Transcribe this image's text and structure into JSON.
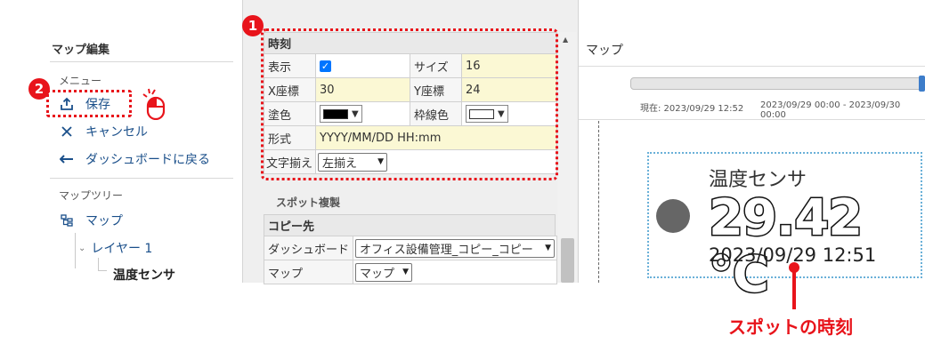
{
  "sidebar": {
    "title": "マップ編集",
    "menu_heading": "メニュー",
    "items": [
      {
        "label": "保存",
        "icon": "upload-icon"
      },
      {
        "label": "キャンセル",
        "icon": "close-icon"
      },
      {
        "label": "ダッシュボードに戻る",
        "icon": "back-arrow-icon"
      }
    ],
    "tree_heading": "マップツリー",
    "tree": {
      "root": "マップ",
      "layer": "レイヤー 1",
      "leaf": "温度センサ"
    }
  },
  "badges": {
    "one": "1",
    "two": "2"
  },
  "properties": {
    "section": "時刻",
    "rows": {
      "display_label": "表示",
      "size_label": "サイズ",
      "size_value": "16",
      "x_label": "X座標",
      "x_value": "30",
      "y_label": "Y座標",
      "y_value": "24",
      "fill_label": "塗色",
      "border_label": "枠線色",
      "format_label": "形式",
      "format_value": "YYYY/MM/DD HH:mm",
      "align_label": "文字揃え",
      "align_value": "左揃え"
    },
    "colors": {
      "fill": "#000000",
      "border": "#ffffff"
    }
  },
  "spot_copy": {
    "title": "スポット複製",
    "dest_header": "コピー先",
    "dashboard_label": "ダッシュボード",
    "dashboard_value": "オフィス設備管理_コピー_コピー",
    "map_label": "マップ",
    "map_value": "マップ"
  },
  "map": {
    "title": "マップ",
    "now_text": "現在: 2023/09/29 12:52",
    "range_text": "2023/09/29 00:00 - 2023/09/30 00:00",
    "spot_name": "温度センサ",
    "spot_value": "29.42 ℃",
    "spot_time": "2023/09/29 12:51"
  },
  "callout": {
    "text": "スポットの時刻"
  },
  "accent": {
    "red": "#e8141b",
    "link": "#1a4f8a",
    "highlight": "#fbf8d4"
  }
}
